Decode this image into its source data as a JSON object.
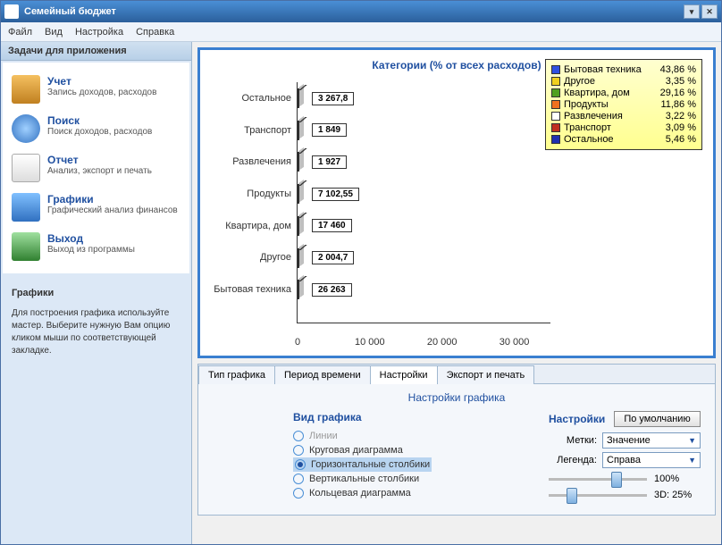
{
  "window_title": "Семейный бюджет",
  "menu": [
    "Файл",
    "Вид",
    "Настройка",
    "Справка"
  ],
  "sidebar": {
    "header": "Задачи для приложения",
    "items": [
      {
        "title": "Учет",
        "desc": "Запись доходов, расходов"
      },
      {
        "title": "Поиск",
        "desc": "Поиск доходов, расходов"
      },
      {
        "title": "Отчет",
        "desc": "Анализ, экспорт и печать"
      },
      {
        "title": "Графики",
        "desc": "Графический анализ финансов"
      },
      {
        "title": "Выход",
        "desc": "Выход из программы"
      }
    ]
  },
  "tips": {
    "title": "Графики",
    "text": "Для построения графика используйте мастер. Выберите нужную Вам опцию кликом мыши по соответствующей закладке."
  },
  "chart_data": {
    "type": "bar",
    "orientation": "horizontal",
    "title": "Категории (% от всех расходов)",
    "categories": [
      "Остальное",
      "Транспорт",
      "Развлечения",
      "Продукты",
      "Квартира, дом",
      "Другое",
      "Бытовая техника"
    ],
    "values": [
      3267.8,
      1849,
      1927,
      7102.55,
      17460,
      2004.7,
      26263
    ],
    "value_labels": [
      "3 267,8",
      "1 849",
      "1 927",
      "7 102,55",
      "17 460",
      "2 004,7",
      "26 263"
    ],
    "colors": [
      "#2030b0",
      "#c03020",
      "#ffffff",
      "#f07020",
      "#50a020",
      "#f0d020",
      "#3050e0"
    ],
    "xticks": [
      0,
      10000,
      20000,
      30000
    ],
    "xtick_labels": [
      "0",
      "10 000",
      "20 000",
      "30 000"
    ],
    "xmax": 35000,
    "legend": [
      {
        "name": "Бытовая техника",
        "pct": "43,86 %",
        "color": "#3050e0"
      },
      {
        "name": "Другое",
        "pct": "3,35 %",
        "color": "#f0d020"
      },
      {
        "name": "Квартира, дом",
        "pct": "29,16 %",
        "color": "#50a020"
      },
      {
        "name": "Продукты",
        "pct": "11,86 %",
        "color": "#f07020"
      },
      {
        "name": "Развлечения",
        "pct": "3,22 %",
        "color": "#ffffff"
      },
      {
        "name": "Транспорт",
        "pct": "3,09 %",
        "color": "#c03020"
      },
      {
        "name": "Остальное",
        "pct": "5,46 %",
        "color": "#2030b0"
      }
    ]
  },
  "tabs": [
    "Тип графика",
    "Период времени",
    "Настройки",
    "Экспорт и печать"
  ],
  "active_tab": 2,
  "settings": {
    "panel_title": "Настройки графика",
    "col1_title": "Вид графика",
    "col2_title": "Настройки",
    "default_btn": "По умолчанию",
    "options": [
      "Линии",
      "Круговая диаграмма",
      "Горизонтальные столбики",
      "Вертикальные столбики",
      "Кольцевая диаграмма"
    ],
    "selected_option": 2,
    "labels_label": "Метки:",
    "labels_value": "Значение",
    "legend_label": "Легенда:",
    "legend_value": "Справа",
    "slider1_label": "100%",
    "slider2_label": "3D: 25%"
  }
}
